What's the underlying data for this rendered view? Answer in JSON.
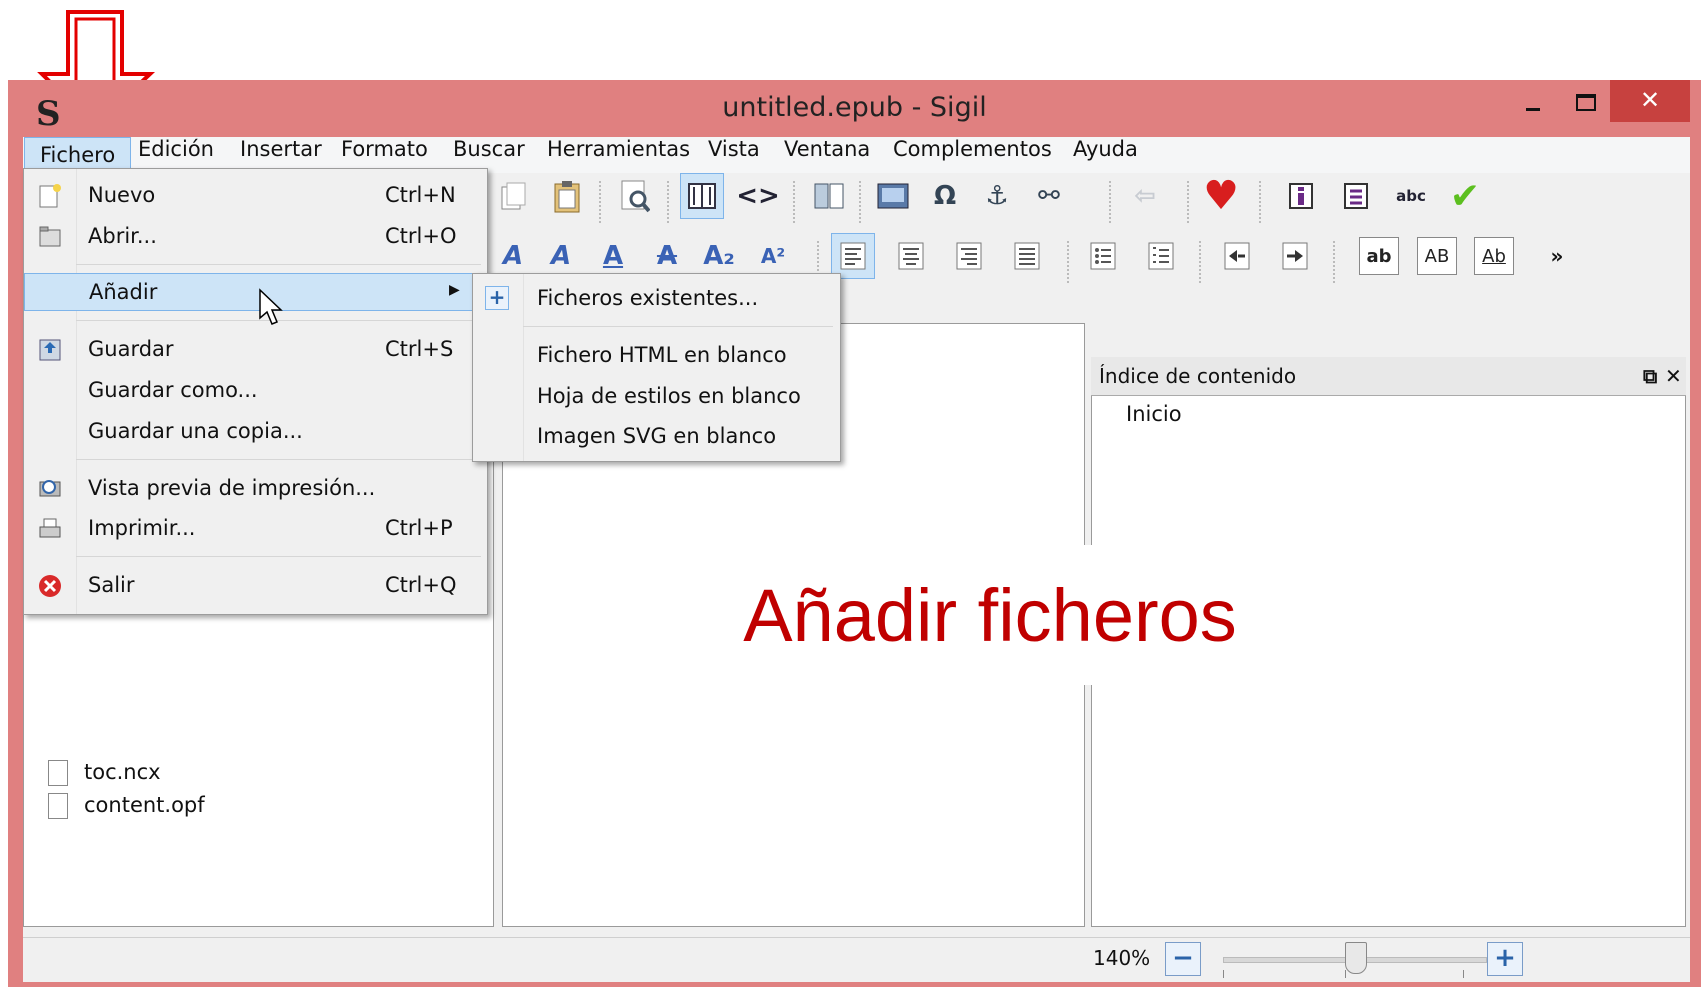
{
  "window": {
    "title": "untitled.epub - Sigil",
    "logo": "S",
    "close_glyph": "✕"
  },
  "menubar": [
    "Fichero",
    "Edición",
    "Insertar",
    "Formato",
    "Buscar",
    "Herramientas",
    "Vista",
    "Ventana",
    "Complementos",
    "Ayuda"
  ],
  "toolbar": {
    "row1": [
      "copy-icon",
      "paste-icon",
      "preview-icon",
      "book-view-icon",
      "code-view-icon",
      "split-icon",
      "image-icon",
      "omega-icon",
      "anchor-icon",
      "link-icon",
      "back-icon",
      "donate-icon",
      "metadata-icon",
      "toc-icon",
      "spellcheck-icon",
      "validate-icon"
    ],
    "row1_glyphs": {
      "omega": "Ω",
      "anchor": "⚓",
      "link": "⚯",
      "back": "⇦",
      "heart": "♥",
      "check": "✔",
      "code": "<>"
    },
    "row2_glyphs": {
      "h3": "A",
      "h4": "A",
      "h5": "A",
      "strike": "A",
      "sub": "A₂",
      "sup": "A²",
      "lower": "ab",
      "upper": "AB",
      "title": "Ab",
      "more": "»"
    }
  },
  "toc_panel": {
    "title": "Índice de contenido",
    "items": [
      "Inicio"
    ],
    "float_glyph": "⧉",
    "close_glyph": "✕"
  },
  "book_browser": {
    "items": [
      "toc.ncx",
      "content.opf"
    ]
  },
  "file_menu": {
    "items": [
      {
        "label": "Nuevo",
        "shortcut": "Ctrl+N"
      },
      {
        "label": "Abrir...",
        "shortcut": "Ctrl+O"
      },
      {
        "label": "Añadir",
        "shortcut": ""
      },
      {
        "label": "Guardar",
        "shortcut": "Ctrl+S"
      },
      {
        "label": "Guardar como...",
        "shortcut": ""
      },
      {
        "label": "Guardar una copia...",
        "shortcut": ""
      },
      {
        "label": "Vista previa de impresión...",
        "shortcut": ""
      },
      {
        "label": "Imprimir...",
        "shortcut": "Ctrl+P"
      },
      {
        "label": "Salir",
        "shortcut": "Ctrl+Q"
      }
    ],
    "submenu_arrow": "▶"
  },
  "add_submenu": {
    "items": [
      "Ficheros existentes...",
      "Fichero HTML en blanco",
      "Hoja de estilos en blanco",
      "Imagen SVG en blanco"
    ],
    "plus": "+"
  },
  "statusbar": {
    "zoom": "140%",
    "zoom_out": "−",
    "zoom_in": "+",
    "zoom_fraction": 0.45
  },
  "overlay": {
    "caption": "Añadir ficheros"
  },
  "colors": {
    "title_bar": "#e08080",
    "close": "#c7413f",
    "highlight": "#cde4f7",
    "overlay_text": "#c00000"
  }
}
